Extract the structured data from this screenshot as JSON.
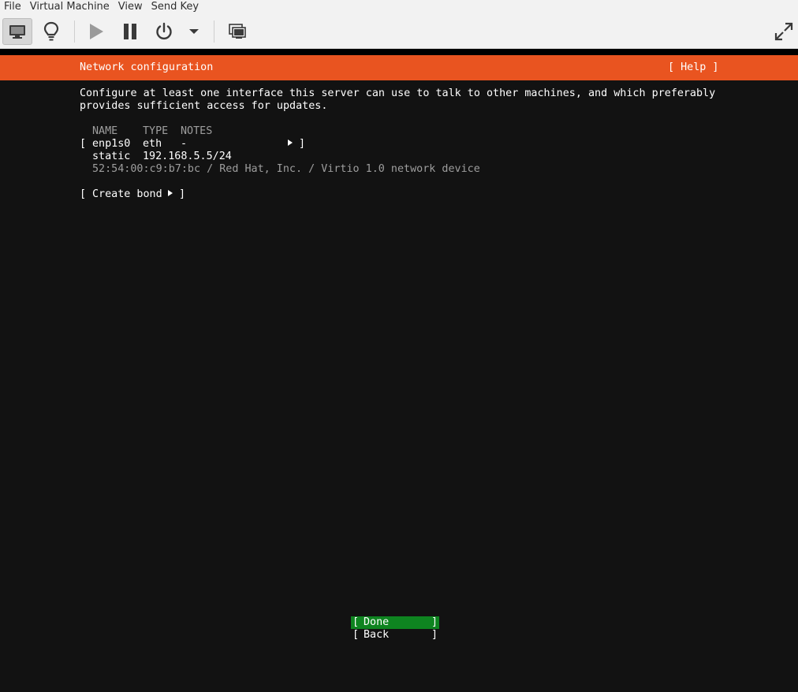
{
  "menubar": {
    "items": [
      "File",
      "Virtual Machine",
      "View",
      "Send Key"
    ]
  },
  "toolbar": {
    "buttons": [
      {
        "icon": "monitor-icon",
        "active": true
      },
      {
        "icon": "lightbulb-icon",
        "active": false
      },
      {
        "icon": "play-icon",
        "active": false
      },
      {
        "icon": "pause-icon",
        "active": false
      },
      {
        "icon": "power-icon",
        "active": false
      },
      {
        "icon": "chevron-down-icon",
        "active": false
      },
      {
        "icon": "snapshot-icon",
        "active": false
      },
      {
        "icon": "fullscreen-icon",
        "active": false
      }
    ]
  },
  "installer": {
    "accent_color": "#e95420",
    "selected_color": "#0e8420",
    "title": "Network configuration",
    "help": "[ Help ]",
    "intro": [
      "Configure at least one interface this server can use to talk to other machines, and which preferably",
      "provides sufficient access for updates."
    ],
    "table": {
      "headers": {
        "name": "NAME",
        "type": "TYPE",
        "notes": "NOTES"
      },
      "interfaces": [
        {
          "name": "enp1s0",
          "type": "eth",
          "notes": "-",
          "address_mode": "static",
          "address": "192.168.5.5/24",
          "description": "52:54:00:c9:b7:bc / Red Hat, Inc. / Virtio 1.0 network device"
        }
      ]
    },
    "create_bond_label": "Create bond",
    "buttons": {
      "done": "Done",
      "back": "Back"
    }
  }
}
